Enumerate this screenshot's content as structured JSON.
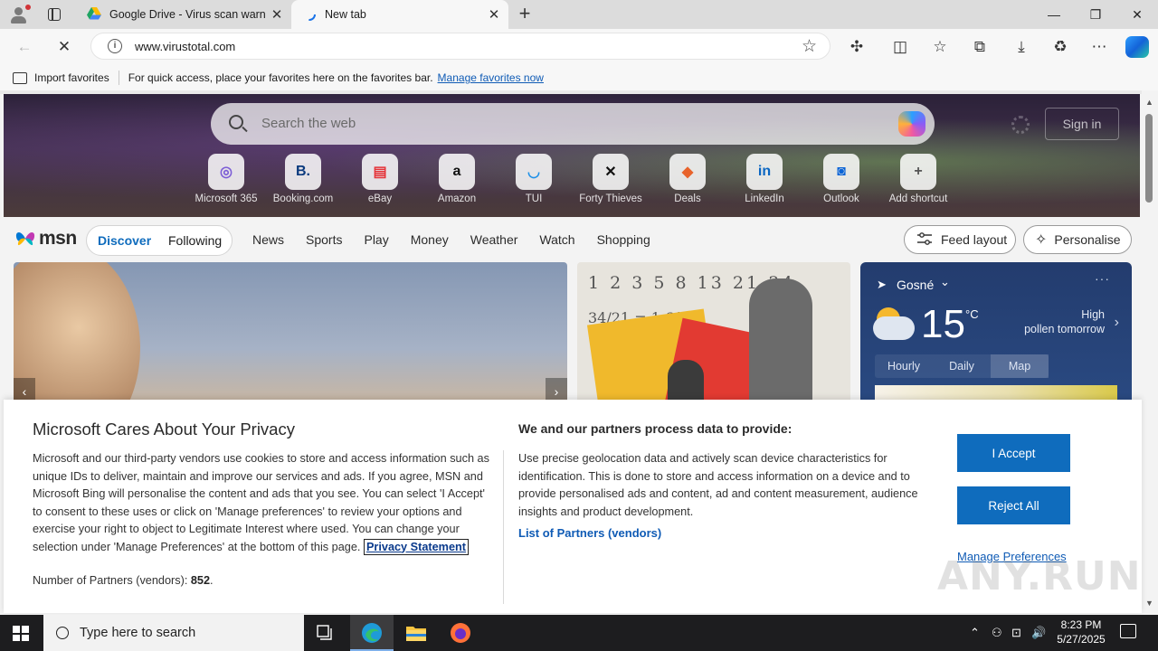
{
  "browser": {
    "tabs": [
      {
        "title": "Google Drive - Virus scan warning",
        "active": false
      },
      {
        "title": "New tab",
        "active": true
      }
    ],
    "tab_close_glyph": "✕",
    "new_tab_glyph": "+",
    "window_controls": {
      "minimize": "—",
      "restore": "❐",
      "close": "✕"
    },
    "address": {
      "url": "www.virustotal.com",
      "info_glyph": "i",
      "star_glyph": "☆"
    },
    "nav": {
      "back": "←",
      "stop": "✕"
    },
    "toolbar_glyphs": {
      "extensions": "✣",
      "split": "◫",
      "favorites": "☆",
      "collections": "⧉",
      "downloads": "⤓",
      "performance": "♻",
      "more": "⋯"
    }
  },
  "favorites_bar": {
    "import_label": "Import favorites",
    "hint": "For quick access, place your favorites here on the favorites bar.",
    "manage_link": "Manage favorites now"
  },
  "newtab": {
    "search_placeholder": "Search the web",
    "sign_in": "Sign in",
    "shortcuts": [
      {
        "label": "Microsoft 365",
        "glyph": "◎",
        "color": "#7b5cd6"
      },
      {
        "label": "Booking.com",
        "glyph": "B.",
        "color": "#0b3a7e"
      },
      {
        "label": "eBay",
        "glyph": "▤",
        "color": "#e53238"
      },
      {
        "label": "Amazon",
        "glyph": "a",
        "color": "#111111"
      },
      {
        "label": "TUI",
        "glyph": "◡",
        "color": "#1e90e8"
      },
      {
        "label": "Forty Thieves",
        "glyph": "✕",
        "color": "#111111"
      },
      {
        "label": "Deals",
        "glyph": "◆",
        "color": "#e8632b"
      },
      {
        "label": "LinkedIn",
        "glyph": "in",
        "color": "#0a66c2"
      },
      {
        "label": "Outlook",
        "glyph": "◙",
        "color": "#0a64d6"
      },
      {
        "label": "Add shortcut",
        "glyph": "+",
        "color": "#555555"
      }
    ]
  },
  "msn": {
    "logo": "msn",
    "feed_tabs": [
      "Discover",
      "Following"
    ],
    "nav_links": [
      "News",
      "Sports",
      "Play",
      "Money",
      "Weather",
      "Watch",
      "Shopping"
    ],
    "feed_layout": "Feed layout",
    "personalise": "Personalise",
    "card2_numbers_line1": "1 2 3 5 8 13 21 34",
    "card2_numbers_line2": "34/21 = 1,618",
    "arrow_left": "‹",
    "arrow_right": "›",
    "weather": {
      "location": "Gosné",
      "location_chevron": "⌄",
      "more": "···",
      "temperature": "15",
      "unit": "°C",
      "pollen_line1": "High",
      "pollen_line2": "pollen tomorrow",
      "chevron": "›",
      "tabs": [
        "Hourly",
        "Daily",
        "Map"
      ],
      "selected_tab": "Map"
    }
  },
  "consent": {
    "title": "Microsoft Cares About Your Privacy",
    "body": "Microsoft and our third-party vendors use cookies to store and access information such as unique IDs to deliver, maintain and improve our services and ads. If you agree, MSN and Microsoft Bing will personalise the content and ads that you see. You can select 'I Accept' to consent to these uses or click on 'Manage preferences' to review your options and exercise your right to object to Legitimate Interest where used. You can change your selection under 'Manage Preferences' at the bottom of this page.",
    "privacy_link": "Privacy Statement",
    "partners_label": "Number of Partners (vendors):",
    "partners_count": "852",
    "partners_suffix": ".",
    "purpose_title": "We and our partners process data to provide:",
    "purpose_text": "Use precise geolocation data and actively scan device characteristics for identification. This is done to store and access information on a device and to provide personalised ads and content, ad and content measurement, audience insights and product development.",
    "vendors_link": "List of Partners (vendors)",
    "accept": "I Accept",
    "reject": "Reject All",
    "manage": "Manage Preferences"
  },
  "watermark": "ANY.RUN",
  "taskbar": {
    "search_placeholder": "Type here to search",
    "time": "8:23 PM",
    "date": "5/27/2025",
    "tray_glyphs": {
      "chevron": "⌃",
      "network": "⊡",
      "volume": "🔊"
    }
  },
  "colors": {
    "accent": "#0f6cbd",
    "link": "#0f5bb5"
  }
}
